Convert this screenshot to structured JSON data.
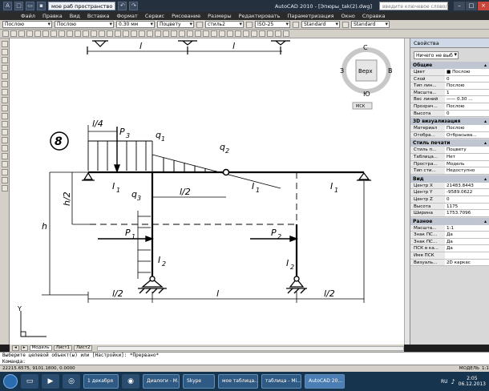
{
  "app": {
    "workspace": "мое раб пространство",
    "window_title": "AutoCAD 2010 - [Эпюры_tak(2).dwg]",
    "search_placeholder": "введите ключевое слово/фразу"
  },
  "menu": [
    "Файл",
    "Правка",
    "Вид",
    "Вставка",
    "Формат",
    "Сервис",
    "Рисование",
    "Размеры",
    "Редактировать",
    "Параметризация",
    "Окно",
    "Справка"
  ],
  "toolbar": {
    "layer": "Послою",
    "linetype": "Послою",
    "lineweight": "0.30 мм",
    "plotstyle": "Поцвету",
    "dimstyle_name": "стиль2",
    "text_style": "ISO-25",
    "standard1": "Standard",
    "standard2": "Standard"
  },
  "viewcube": {
    "north": "С",
    "south": "Ю",
    "west": "З",
    "east": "В",
    "face": "Верх",
    "ucs": "МСК"
  },
  "drawing": {
    "top_dim_left": "l",
    "top_dim_right": "l",
    "problem_number": "8",
    "label_l4": "l/4",
    "label_p3": "P",
    "label_p3_sub": "3",
    "label_q1": "q",
    "label_q1_sub": "1",
    "label_q2": "q",
    "label_q2_sub": "2",
    "label_q3": "q",
    "label_q3_sub": "3",
    "label_i1a": "I",
    "label_i1a_sub": "1",
    "label_i1b": "I",
    "label_i1b_sub": "1",
    "label_i1c": "I",
    "label_i1c_sub": "1",
    "label_i2a": "I",
    "label_i2a_sub": "2",
    "label_i2b": "I",
    "label_i2b_sub": "2",
    "label_l2_mid": "l/2",
    "label_h2": "h/2",
    "label_h": "h",
    "label_p1": "P",
    "label_p1_sub": "1",
    "label_p2": "P",
    "label_p2_sub": "2",
    "bottom_l2_left": "l/2",
    "bottom_l": "l",
    "bottom_l2_right": "l/2",
    "axis_y": "Y"
  },
  "properties": {
    "header": "Свойства",
    "selection": "Ничего не выб",
    "sections": [
      {
        "title": "Общие",
        "rows": [
          {
            "k": "Цвет",
            "v": "■ Послою"
          },
          {
            "k": "Слой",
            "v": "0"
          },
          {
            "k": "Тип лин...",
            "v": "Послою"
          },
          {
            "k": "Масшта...",
            "v": "1"
          },
          {
            "k": "Вес линий",
            "v": "—— 0.30 ..."
          },
          {
            "k": "Прозрач...",
            "v": "Послою"
          },
          {
            "k": "Высота",
            "v": "0"
          }
        ]
      },
      {
        "title": "3D визуализация",
        "rows": [
          {
            "k": "Материал",
            "v": "Послою"
          },
          {
            "k": "Отобра...",
            "v": "Отбрасыва..."
          }
        ]
      },
      {
        "title": "Стиль печати",
        "rows": [
          {
            "k": "Стиль п...",
            "v": "Поцвету"
          },
          {
            "k": "Таблица...",
            "v": "Нет"
          },
          {
            "k": "Простра...",
            "v": "Модель"
          },
          {
            "k": "Тип сти...",
            "v": "Недоступно"
          }
        ]
      },
      {
        "title": "Вид",
        "rows": [
          {
            "k": "Центр X",
            "v": "21483.8443"
          },
          {
            "k": "Центр Y",
            "v": "-9589.0622"
          },
          {
            "k": "Центр Z",
            "v": "0"
          },
          {
            "k": "Высота",
            "v": "1175"
          },
          {
            "k": "Ширина",
            "v": "1753.7096"
          }
        ]
      },
      {
        "title": "Разное",
        "rows": [
          {
            "k": "Масшта...",
            "v": "1:1"
          },
          {
            "k": "Знак ПС...",
            "v": "Да"
          },
          {
            "k": "Знак ПС...",
            "v": "Да"
          },
          {
            "k": "ПСК в ка...",
            "v": "Да"
          },
          {
            "k": "Имя ПСК",
            "v": ""
          },
          {
            "k": "Визуаль...",
            "v": "2D каркас"
          }
        ]
      }
    ]
  },
  "layout_tabs": [
    "Модель",
    "Лист1",
    "Лист2"
  ],
  "command": {
    "line1": "Выберите целевой объект(ы) или [Настройки]: *Прервано*",
    "line2": "Команда:"
  },
  "status": {
    "coords": "22215.6575, 9101.1800, 0.0000",
    "model": "МОДЕЛЬ",
    "scale": "1:1"
  },
  "taskbar": {
    "items": [
      "1 декабря",
      "Диалоги - M...",
      "Skype",
      "мое таблица...",
      "таблица - Mi...",
      "AutoCAD 20..."
    ],
    "lang": "RU",
    "time": "2:05",
    "date": "06.12.2013"
  }
}
